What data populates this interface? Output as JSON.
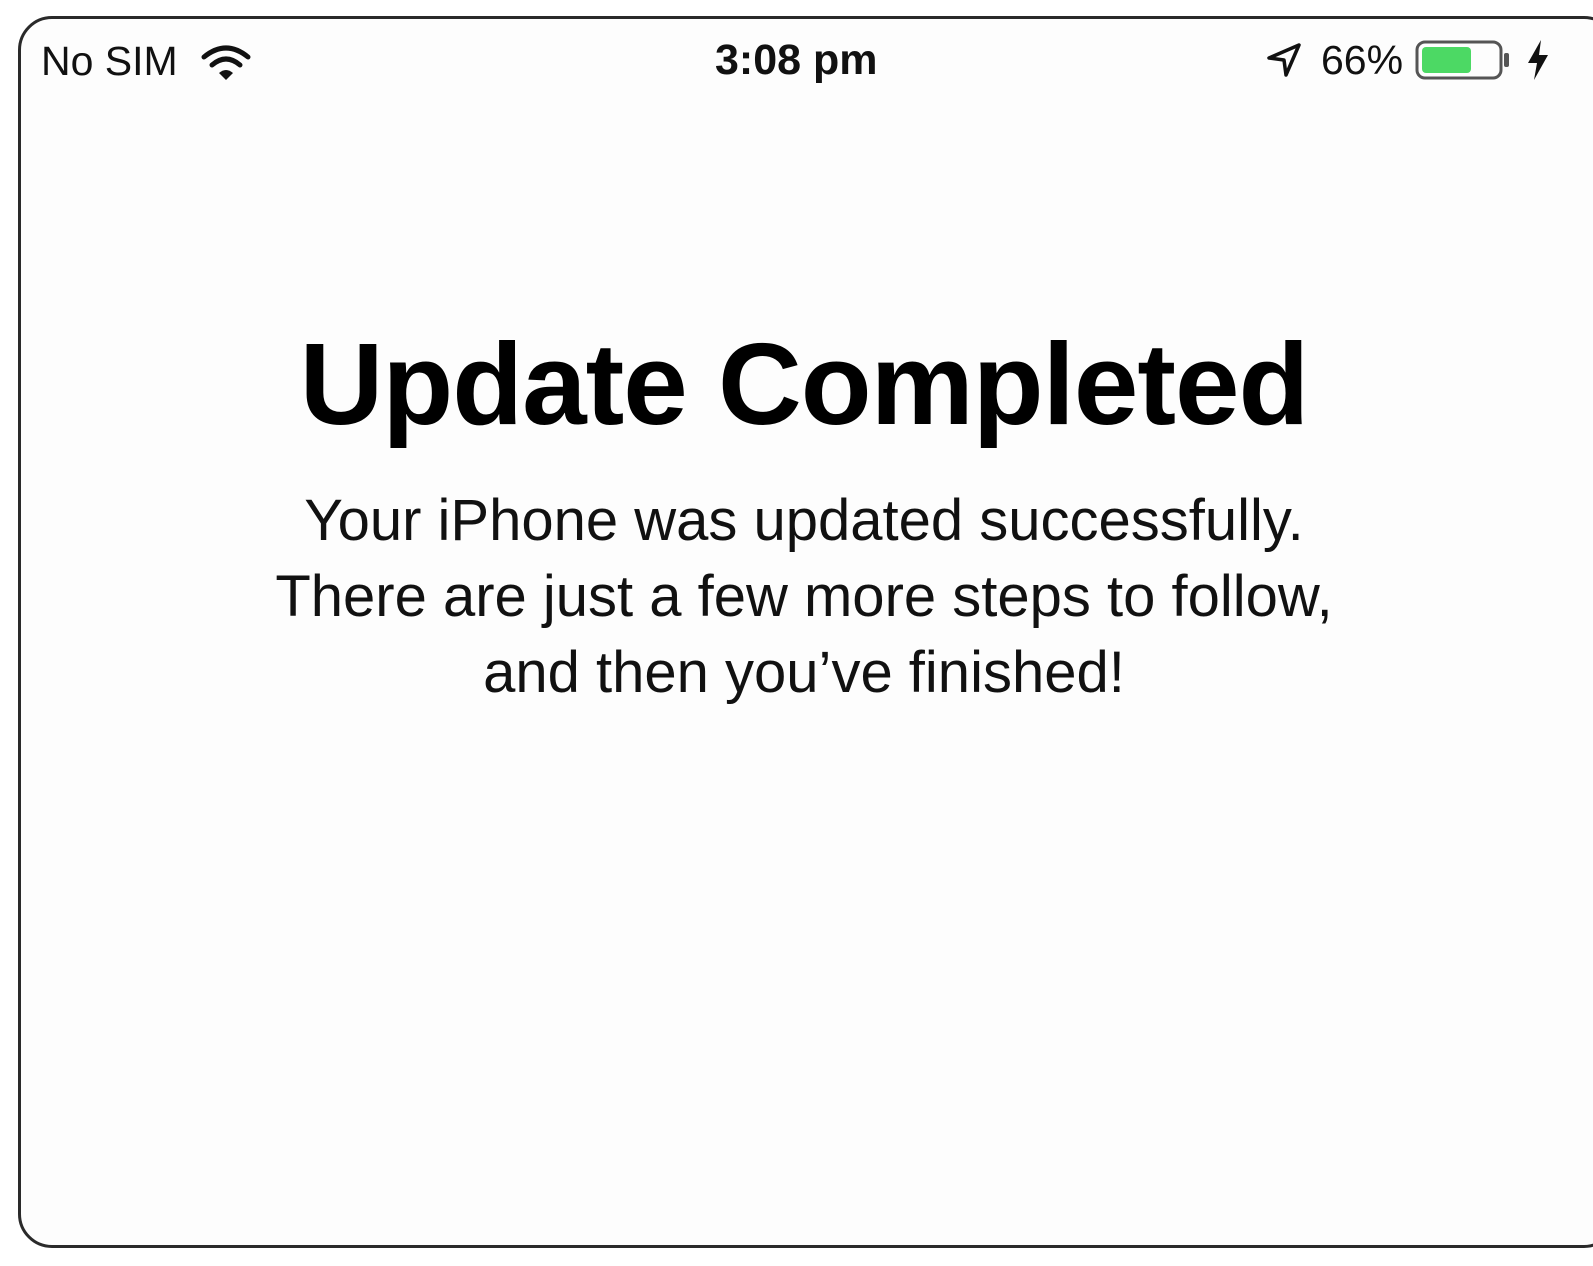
{
  "status_bar": {
    "carrier": "No SIM",
    "time": "3:08 pm",
    "battery_percent": "66%",
    "battery_level": 0.66,
    "wifi_icon": "wifi-icon",
    "location_icon": "location-arrow-icon",
    "charging_icon": "charging-bolt-icon"
  },
  "screen": {
    "title": "Update Completed",
    "message_lines": [
      "Your iPhone was updated successfully.",
      "There are just a few more steps to follow,",
      "and then you’ve finished!"
    ]
  },
  "colors": {
    "battery_fill": "#4cd964",
    "text": "#000000"
  }
}
